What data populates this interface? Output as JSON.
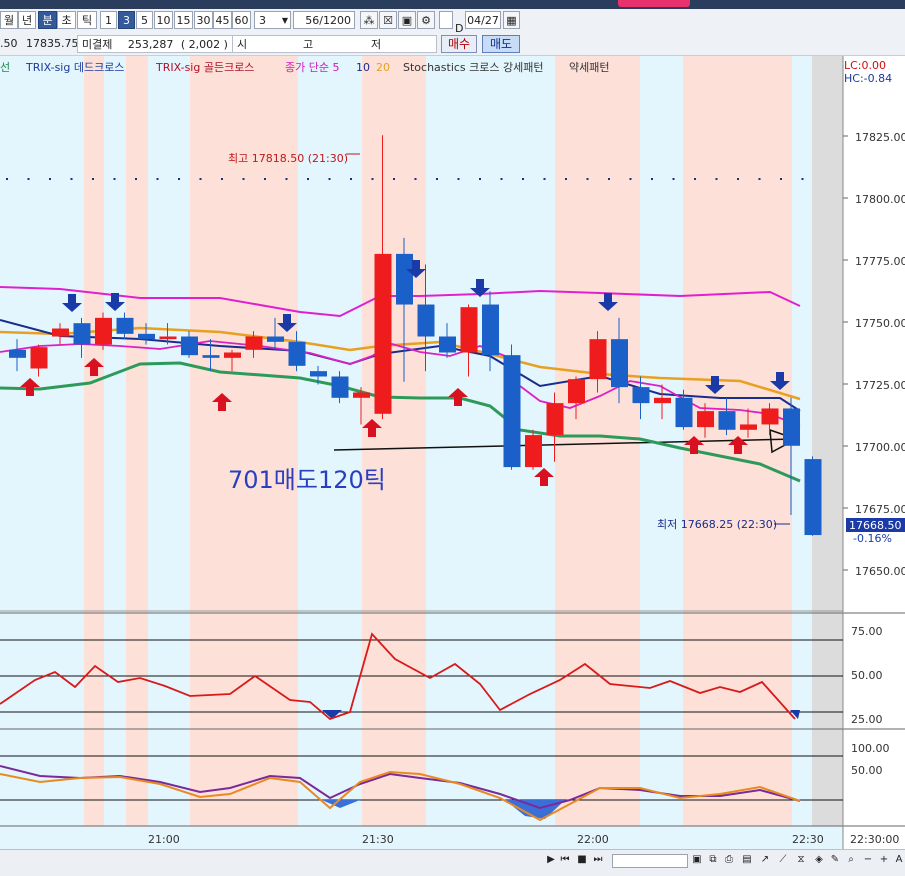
{
  "toolbar": {
    "period_buttons": [
      "월",
      "년",
      "분",
      "초",
      "틱"
    ],
    "selected_period": "분",
    "interval_buttons": [
      "1",
      "3",
      "5",
      "10",
      "15",
      "30",
      "45",
      "60"
    ],
    "selected_interval": "3",
    "interval_select": "3",
    "count_display": "56/1200",
    "d_label": "D",
    "date_value": "04/27"
  },
  "infobar": {
    "price_prev": ".50",
    "price_current": "17835.75",
    "open_interest_label": "미결제",
    "open_interest_value": "253,287",
    "open_interest_change": "( 2,002 )",
    "col_open": "시",
    "col_high": "고",
    "col_low": "저",
    "buy_label": "매수",
    "sell_label": "매도"
  },
  "legend": {
    "item0": "선",
    "item1": "TRIX-sig 데드크로스",
    "item2": "TRIX-sig 골든크로스",
    "item3": "종가 단순 5",
    "item4": "10",
    "item5": "20",
    "item6": "Stochastics 크로스 강세패턴",
    "item7": "약세패턴"
  },
  "right_axis": {
    "lc": "LC:0.00",
    "hc": "HC:-0.84",
    "price_ticks": [
      "17825.00",
      "17800.00",
      "17775.00",
      "17750.00",
      "17725.00",
      "17700.00",
      "17675.00",
      "17650.00"
    ],
    "current_price_tag": "17668.50",
    "change_pct": "-0.16%",
    "stoch_ticks": [
      "75.00",
      "50.00",
      "25.00"
    ],
    "osc_ticks": [
      "100.00",
      "50.00"
    ],
    "time_label": "22:30:00"
  },
  "annotations": {
    "high_label": "최고 17818.50 (21:30)",
    "low_label": "최저 17668.25 (22:30)",
    "user_note": "701매도120틱"
  },
  "time_axis": [
    "21:00",
    "21:30",
    "22:00",
    "22:30"
  ],
  "colors": {
    "up_candle": "#ee1c1c",
    "down_candle": "#1b5fc8",
    "ma5": "#dd20c4",
    "ma10": "#1a2c8c",
    "ma20_upper": "#e8a020",
    "ma_lower": "#2e9a5a",
    "band_upper": "#e020d0",
    "bg_light_blue": "#e3f5fd",
    "bg_pink": "#fde0d8",
    "buy_arrow": "#d81020",
    "sell_arrow": "#1a3aa8",
    "stoch_line": "#d81a1a",
    "osc_orange": "#e88a20",
    "osc_purple": "#7a2a9a"
  },
  "chart_data": {
    "type": "candlestick",
    "interval_minutes": 3,
    "ylim": [
      17640,
      17840
    ],
    "candles": [
      {
        "open": 17738,
        "high": 17742,
        "low": 17730,
        "close": 17735
      },
      {
        "open": 17731,
        "high": 17740,
        "low": 17728,
        "close": 17739
      },
      {
        "open": 17743,
        "high": 17748,
        "low": 17740,
        "close": 17746
      },
      {
        "open": 17748,
        "high": 17750,
        "low": 17735,
        "close": 17740
      },
      {
        "open": 17740,
        "high": 17752,
        "low": 17738,
        "close": 17750
      },
      {
        "open": 17750,
        "high": 17752,
        "low": 17742,
        "close": 17744
      },
      {
        "open": 17744,
        "high": 17748,
        "low": 17740,
        "close": 17742
      },
      {
        "open": 17742,
        "high": 17748,
        "low": 17740,
        "close": 17743
      },
      {
        "open": 17743,
        "high": 17745,
        "low": 17735,
        "close": 17736
      },
      {
        "open": 17736,
        "high": 17742,
        "low": 17730,
        "close": 17735
      },
      {
        "open": 17735,
        "high": 17738,
        "low": 17730,
        "close": 17737
      },
      {
        "open": 17738,
        "high": 17745,
        "low": 17735,
        "close": 17743
      },
      {
        "open": 17743,
        "high": 17750,
        "low": 17738,
        "close": 17741
      },
      {
        "open": 17741,
        "high": 17745,
        "low": 17730,
        "close": 17732
      },
      {
        "open": 17730,
        "high": 17732,
        "low": 17725,
        "close": 17728
      },
      {
        "open": 17728,
        "high": 17730,
        "low": 17718,
        "close": 17720
      },
      {
        "open": 17720,
        "high": 17724,
        "low": 17710,
        "close": 17722
      },
      {
        "open": 17714,
        "high": 17818.5,
        "low": 17712,
        "close": 17774
      },
      {
        "open": 17774,
        "high": 17780,
        "low": 17726,
        "close": 17755
      },
      {
        "open": 17755,
        "high": 17770,
        "low": 17730,
        "close": 17743
      },
      {
        "open": 17743,
        "high": 17748,
        "low": 17735,
        "close": 17737
      },
      {
        "open": 17737,
        "high": 17755,
        "low": 17728,
        "close": 17754
      },
      {
        "open": 17755,
        "high": 17760,
        "low": 17730,
        "close": 17736
      },
      {
        "open": 17736,
        "high": 17740,
        "low": 17693,
        "close": 17694
      },
      {
        "open": 17694,
        "high": 17708,
        "low": 17693,
        "close": 17706
      },
      {
        "open": 17706,
        "high": 17722,
        "low": 17696,
        "close": 17718
      },
      {
        "open": 17718,
        "high": 17728,
        "low": 17712,
        "close": 17727
      },
      {
        "open": 17727,
        "high": 17745,
        "low": 17722,
        "close": 17742
      },
      {
        "open": 17742,
        "high": 17750,
        "low": 17718,
        "close": 17724
      },
      {
        "open": 17724,
        "high": 17728,
        "low": 17712,
        "close": 17718
      },
      {
        "open": 17718,
        "high": 17725,
        "low": 17712,
        "close": 17720
      },
      {
        "open": 17720,
        "high": 17723,
        "low": 17708,
        "close": 17709
      },
      {
        "open": 17709,
        "high": 17718,
        "low": 17705,
        "close": 17715
      },
      {
        "open": 17715,
        "high": 17720,
        "low": 17706,
        "close": 17708
      },
      {
        "open": 17708,
        "high": 17716,
        "low": 17705,
        "close": 17710
      },
      {
        "open": 17710,
        "high": 17718,
        "low": 17706,
        "close": 17716
      },
      {
        "open": 17716,
        "high": 17720,
        "low": 17676,
        "close": 17702
      },
      {
        "open": 17697,
        "high": 17698,
        "low": 17668.25,
        "close": 17668.5
      }
    ],
    "buy_signals": [
      1,
      4,
      10,
      17,
      21,
      25,
      33,
      35
    ],
    "sell_signals": [
      3,
      5,
      13,
      18,
      22,
      28,
      33,
      36
    ]
  }
}
